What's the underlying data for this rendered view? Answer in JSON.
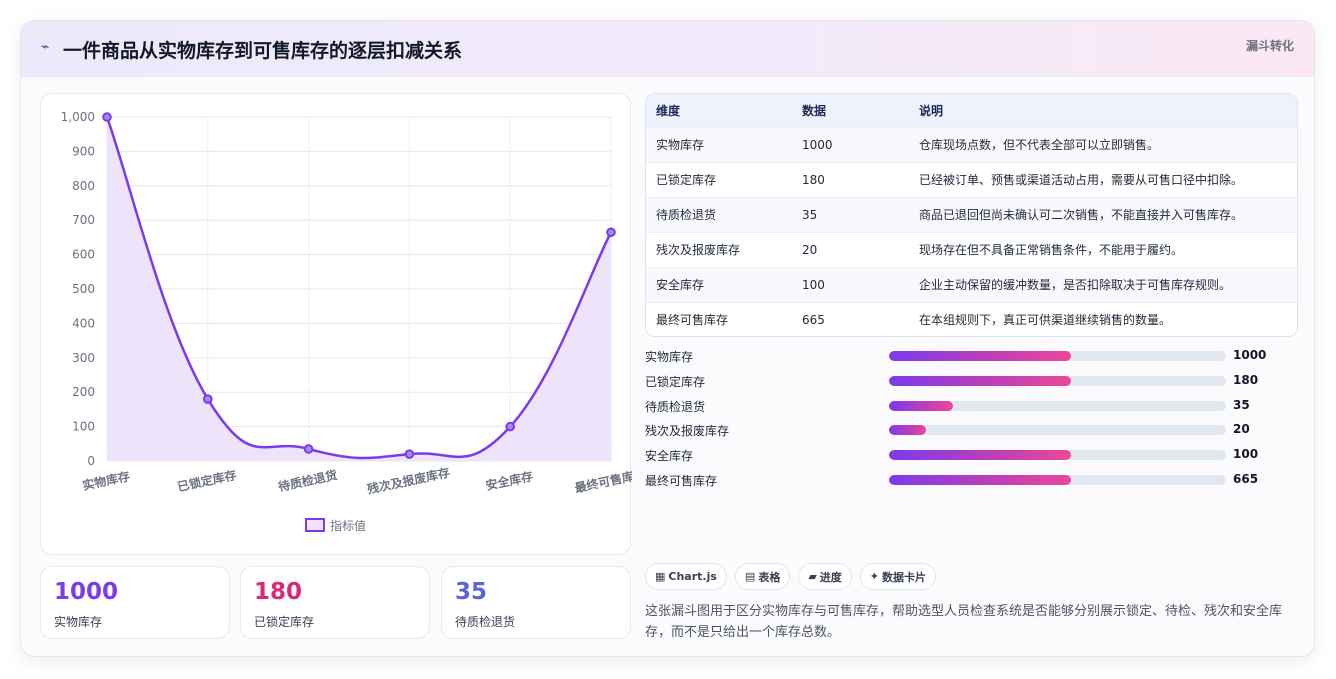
{
  "header": {
    "icon": "bolt-icon",
    "title": "一件商品从实物库存到可售库存的逐层扣减关系",
    "tag": "漏斗转化"
  },
  "colors": {
    "accent": "#7c3aed",
    "accent_pink": "#ec4899",
    "accent_blue": "#6366f1",
    "area_fill": "#ede4fb"
  },
  "chart_data": {
    "type": "line",
    "categories": [
      "实物库存",
      "已锁定库存",
      "待质检退货",
      "残次及报废库存",
      "安全库存",
      "最终可售库存"
    ],
    "series": [
      {
        "name": "指标值",
        "values": [
          1000,
          180,
          35,
          20,
          100,
          665
        ]
      }
    ],
    "ylim": [
      0,
      1000
    ],
    "yticks": [
      "1,000",
      "900",
      "800",
      "700",
      "600",
      "500",
      "400",
      "300",
      "200",
      "100",
      "0"
    ],
    "area": true,
    "smooth": true,
    "grid": true,
    "legend": "bottom"
  },
  "stats": [
    {
      "value": "1000",
      "label": "实物库存",
      "color": "#7c3aed"
    },
    {
      "value": "180",
      "label": "已锁定库存",
      "color": "#db2777"
    },
    {
      "value": "35",
      "label": "待质检退货",
      "color": "#5b63d6"
    }
  ],
  "table": {
    "headers": [
      "维度",
      "数据",
      "说明"
    ],
    "rows": [
      [
        "实物库存",
        "1000",
        "仓库现场点数，但不代表全部可以立即销售。"
      ],
      [
        "已锁定库存",
        "180",
        "已经被订单、预售或渠道活动占用，需要从可售口径中扣除。"
      ],
      [
        "待质检退货",
        "35",
        "商品已退回但尚未确认可二次销售，不能直接并入可售库存。"
      ],
      [
        "残次及报废库存",
        "20",
        "现场存在但不具备正常销售条件，不能用于履约。"
      ],
      [
        "安全库存",
        "100",
        "企业主动保留的缓冲数量，是否扣除取决于可售库存规则。"
      ],
      [
        "最终可售库存",
        "665",
        "在本组规则下，真正可供渠道继续销售的数量。"
      ]
    ]
  },
  "progress": [
    {
      "label": "实物库存",
      "value": "1000",
      "fraction": 0.54
    },
    {
      "label": "已锁定库存",
      "value": "180",
      "fraction": 0.54
    },
    {
      "label": "待质检退货",
      "value": "35",
      "fraction": 0.19
    },
    {
      "label": "残次及报废库存",
      "value": "20",
      "fraction": 0.11
    },
    {
      "label": "安全库存",
      "value": "100",
      "fraction": 0.54
    },
    {
      "label": "最终可售库存",
      "value": "665",
      "fraction": 0.54
    }
  ],
  "chips": [
    {
      "icon": "chart-icon",
      "glyph": "▦",
      "label": "Chart.js"
    },
    {
      "icon": "table-icon",
      "glyph": "▤",
      "label": "表格"
    },
    {
      "icon": "progress-icon",
      "glyph": "▰",
      "label": "进度"
    },
    {
      "icon": "sparkle-icon",
      "glyph": "✦",
      "label": "数据卡片"
    }
  ],
  "description": "这张漏斗图用于区分实物库存与可售库存，帮助选型人员检查系统是否能够分别展示锁定、待检、残次和安全库存，而不是只给出一个库存总数。"
}
